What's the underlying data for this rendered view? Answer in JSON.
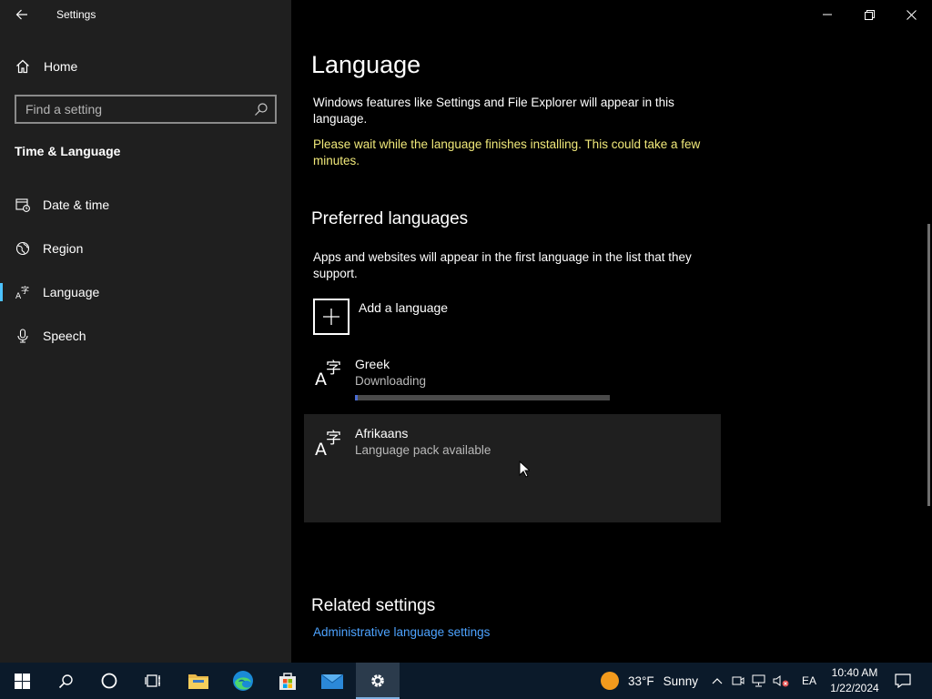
{
  "window": {
    "app_title": "Settings"
  },
  "sidebar": {
    "home_label": "Home",
    "search_placeholder": "Find a setting",
    "section_title": "Time & Language",
    "items": [
      {
        "label": "Date & time",
        "icon": "calendar-clock-icon"
      },
      {
        "label": "Region",
        "icon": "globe-icon"
      },
      {
        "label": "Language",
        "icon": "language-icon",
        "active": true
      },
      {
        "label": "Speech",
        "icon": "microphone-icon"
      }
    ]
  },
  "main": {
    "title": "Language",
    "description": "Windows features like Settings and File Explorer will appear in this language.",
    "warning": "Please wait while the language finishes installing. This could take a few minutes.",
    "warning_color": "#f1e97a",
    "preferred": {
      "heading": "Preferred languages",
      "description": "Apps and websites will appear in the first language in the list that they support.",
      "add_label": "Add a language",
      "languages": [
        {
          "name": "Greek",
          "status": "Downloading",
          "progress": 0.01
        },
        {
          "name": "Afrikaans",
          "status": "Language pack available",
          "selected": true
        }
      ]
    },
    "related": {
      "heading": "Related settings",
      "link": "Administrative language settings"
    }
  },
  "taskbar": {
    "weather_temp": "33°F",
    "weather_text": "Sunny",
    "input_indicator": "EA",
    "time": "10:40 AM",
    "date": "1/22/2024"
  },
  "colors": {
    "accent": "#4cc2ff",
    "link": "#4da3ff",
    "nav_bg": "#1f1f1f",
    "taskbar_bg": "#0b1a2a"
  }
}
